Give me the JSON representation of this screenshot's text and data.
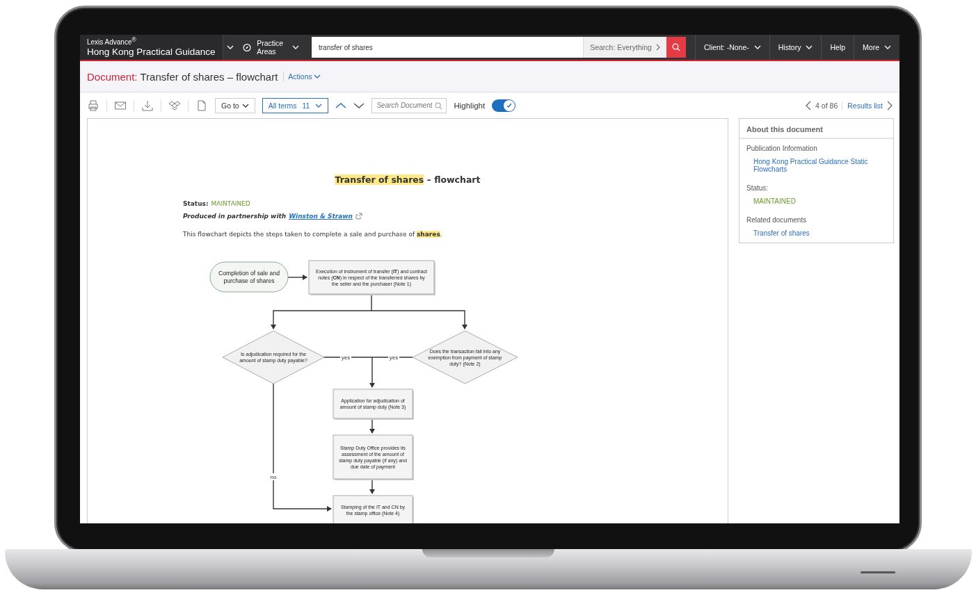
{
  "brand": {
    "product": "Lexis Advance$^{®}$",
    "title": "Hong Kong Practical Guidance"
  },
  "nav": {
    "practice_areas": "Practice Areas"
  },
  "search": {
    "value": "transfer of shares",
    "scope": "Search: Everything"
  },
  "menu": [
    {
      "label": "Client: -None-",
      "dropdown": true
    },
    {
      "label": "History",
      "dropdown": true
    },
    {
      "label": "Help",
      "dropdown": false
    },
    {
      "label": "More",
      "dropdown": true
    }
  ],
  "document_header": {
    "prefix": "Document:",
    "title": "Transfer of shares – flowchart",
    "actions": "Actions"
  },
  "toolbar": {
    "goto": "Go to",
    "terms": "All terms",
    "term_count": "11",
    "search_placeholder": "Search Document",
    "highlight_label": "Highlight",
    "highlight_on": true,
    "position": "4 of 86",
    "results_list": "Results list"
  },
  "document": {
    "heading": "**Transfer of shares** – flowchart",
    "status_label": "Status:",
    "status": "MAINTAINED",
    "partnership": "Produced in partnership with",
    "partner": "Winston & Strawn",
    "intro": "This flowchart depicts the steps taken to complete a sale and purchase of **shares**.",
    "flowchart": {
      "nodes": [
        {
          "kind": "terminal",
          "text": "Completion of sale and purchase of shares"
        },
        {
          "kind": "process",
          "text": "Execution of instrument of transfer (**IT**) and contract notes (**CN**) in respect of the transferred shares by the seller and the purchaser (Note 1)"
        },
        {
          "kind": "decision",
          "text": "Is adjudication required for the amount of stamp duty payable?"
        },
        {
          "kind": "decision",
          "text": "Does the transaction fall into any exemption from payment of stamp duty? (Note 2)"
        },
        {
          "kind": "process",
          "text": "Application for adjudication of amount of stamp duty (Note 3)"
        },
        {
          "kind": "process",
          "text": "Stamp Duty Office provides its assessment of the amount of stamp duty payable (if any) and due date of payment"
        },
        {
          "kind": "process",
          "text": "Stamping of the IT and CN by the stamp office (Note 4)"
        }
      ],
      "branch_labels": [
        "yes",
        "yes",
        "no"
      ]
    }
  },
  "sidebar": {
    "title": "About this document",
    "sections": [
      {
        "kind": "link",
        "label": "Publication Information",
        "value": "Hong Kong Practical Guidance Static Flowcharts"
      },
      {
        "kind": "status",
        "label": "Status:",
        "value": "MAINTAINED"
      },
      {
        "kind": "link",
        "label": "Related documents",
        "value": "Transfer of shares"
      }
    ]
  }
}
